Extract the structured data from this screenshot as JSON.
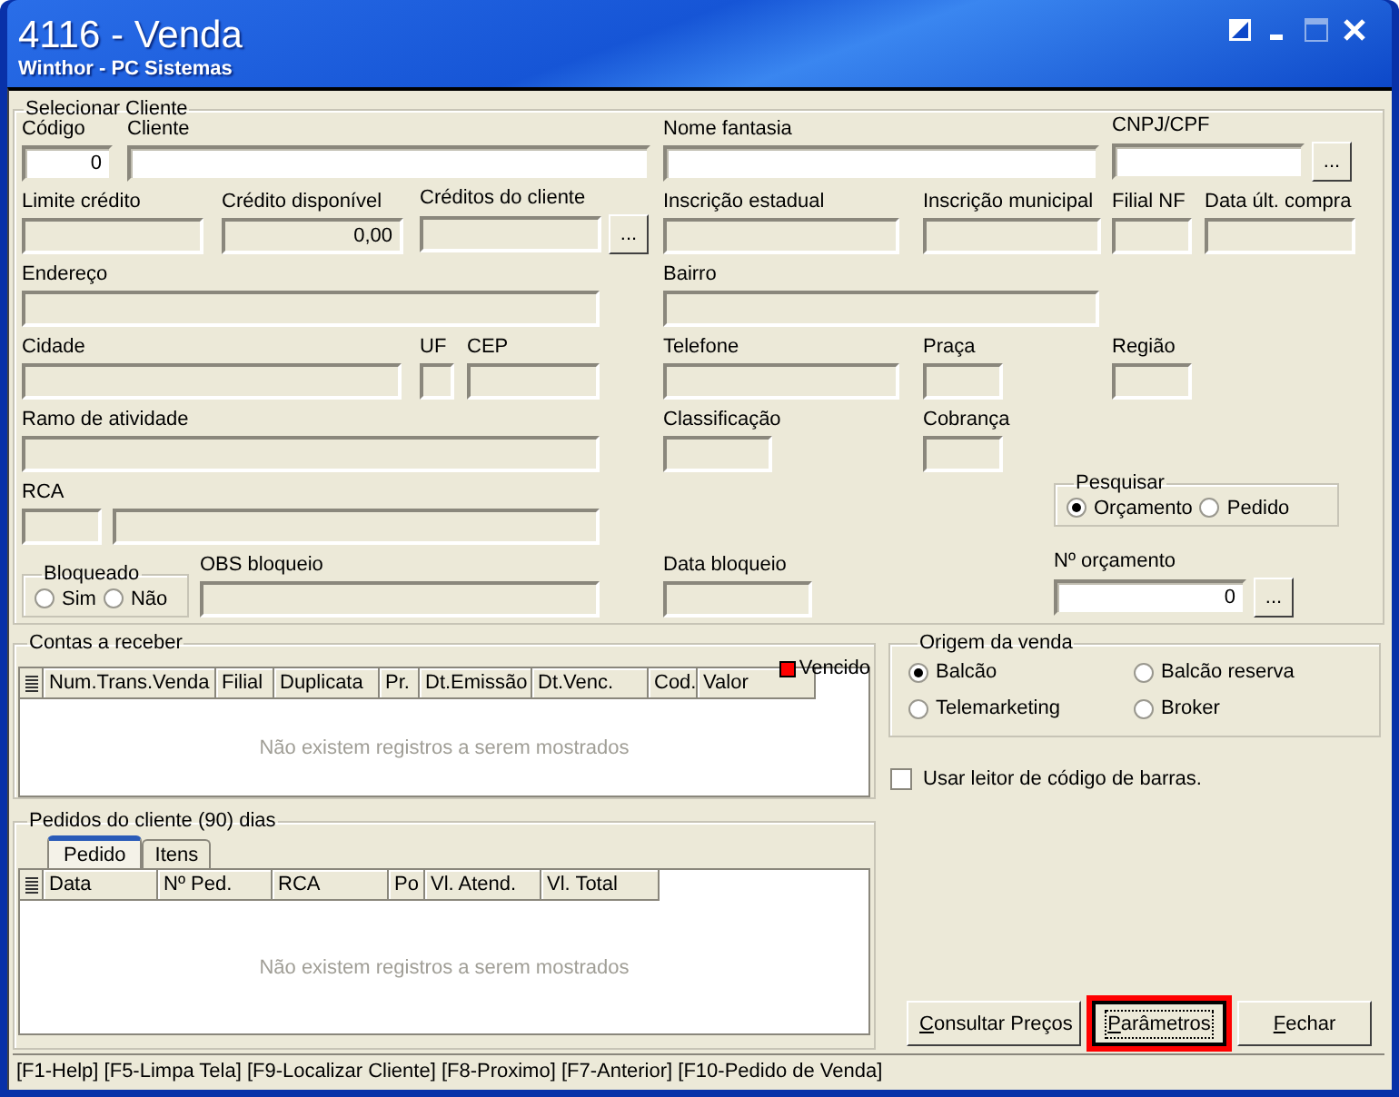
{
  "window": {
    "title": "4116 - Venda",
    "subtitle": "Winthor - PC Sistemas"
  },
  "client_group": {
    "title": "Selecionar Cliente",
    "fields": [
      {
        "kind": "input",
        "label": "Código",
        "value": "0"
      },
      {
        "kind": "input",
        "label": "Cliente"
      },
      {
        "kind": "input",
        "label": "Nome fantasia"
      },
      {
        "kind": "input",
        "label": "CNPJ/CPF",
        "button": "..."
      },
      {
        "kind": "readonly",
        "label": "Limite crédito"
      },
      {
        "kind": "readonly",
        "label": "Crédito disponível",
        "value": "0,00"
      },
      {
        "kind": "readonly",
        "label": "Créditos do cliente",
        "button": "..."
      },
      {
        "kind": "readonly",
        "label": "Inscrição estadual"
      },
      {
        "kind": "readonly",
        "label": "Inscrição municipal"
      },
      {
        "kind": "readonly",
        "label": "Filial NF"
      },
      {
        "kind": "readonly",
        "label": "Data últ. compra"
      },
      {
        "kind": "readonly",
        "label": "Endereço"
      },
      {
        "kind": "readonly",
        "label": "Bairro"
      },
      {
        "kind": "readonly",
        "label": "Cidade"
      },
      {
        "kind": "readonly",
        "label": "UF"
      },
      {
        "kind": "readonly",
        "label": "CEP"
      },
      {
        "kind": "readonly",
        "label": "Telefone"
      },
      {
        "kind": "readonly",
        "label": "Praça"
      },
      {
        "kind": "readonly",
        "label": "Região"
      },
      {
        "kind": "readonly",
        "label": "Ramo de atividade"
      },
      {
        "kind": "readonly",
        "label": "Classificação"
      },
      {
        "kind": "readonly",
        "label": "Cobrança"
      },
      {
        "kind": "readonly",
        "label": "RCA"
      },
      {
        "kind": "readonly"
      },
      {
        "kind": "radio_group",
        "title": "Pesquisar",
        "options": [
          {
            "label": "Orçamento",
            "selected": true
          },
          {
            "label": "Pedido",
            "selected": false
          }
        ]
      },
      {
        "kind": "radio_group",
        "title": "Bloqueado",
        "options": [
          {
            "label": "Sim",
            "selected": false
          },
          {
            "label": "Não",
            "selected": false
          }
        ]
      },
      {
        "kind": "readonly",
        "label": "OBS bloqueio"
      },
      {
        "kind": "readonly",
        "label": "Data bloqueio"
      },
      {
        "kind": "input",
        "label": "Nº orçamento",
        "value": "0",
        "button": "..."
      }
    ]
  },
  "receivables": {
    "title": "Contas a receber",
    "legend": {
      "label": "Vencido",
      "color": "#ff0000"
    },
    "columns": [
      "Num.Trans.Venda",
      "Filial",
      "Duplicata",
      "Pr.",
      "Dt.Emissão",
      "Dt.Venc.",
      "Cod.",
      "Valor"
    ],
    "empty_message": "Não existem registros a serem mostrados"
  },
  "orders": {
    "title": "Pedidos do cliente (90) dias",
    "tabs": [
      {
        "label": "Pedido",
        "selected": true
      },
      {
        "label": "Itens",
        "selected": false
      }
    ],
    "columns": [
      "Data",
      "Nº Ped.",
      "RCA",
      "Po",
      "Vl. Atend.",
      "Vl. Total"
    ],
    "empty_message": "Não existem registros a serem mostrados"
  },
  "sale_origin": {
    "title": "Origem da venda",
    "options": [
      {
        "label": "Balcão",
        "selected": true
      },
      {
        "label": "Balcão reserva",
        "selected": false
      },
      {
        "label": "Telemarketing",
        "selected": false
      },
      {
        "label": "Broker",
        "selected": false
      }
    ]
  },
  "barcode_option": {
    "label": "Usar leitor de código de barras.",
    "checked": false
  },
  "buttons": [
    {
      "label": "Consultar Preços",
      "mnemonic": true,
      "highlighted": false
    },
    {
      "label": "Parâmetros",
      "mnemonic": true,
      "highlighted": true
    },
    {
      "label": "Fechar",
      "mnemonic": true,
      "highlighted": false
    }
  ],
  "status_bar": "[F1-Help] [F5-Limpa Tela] [F9-Localizar Cliente] [F8-Proximo] [F7-Anterior] [F10-Pedido de Venda]"
}
